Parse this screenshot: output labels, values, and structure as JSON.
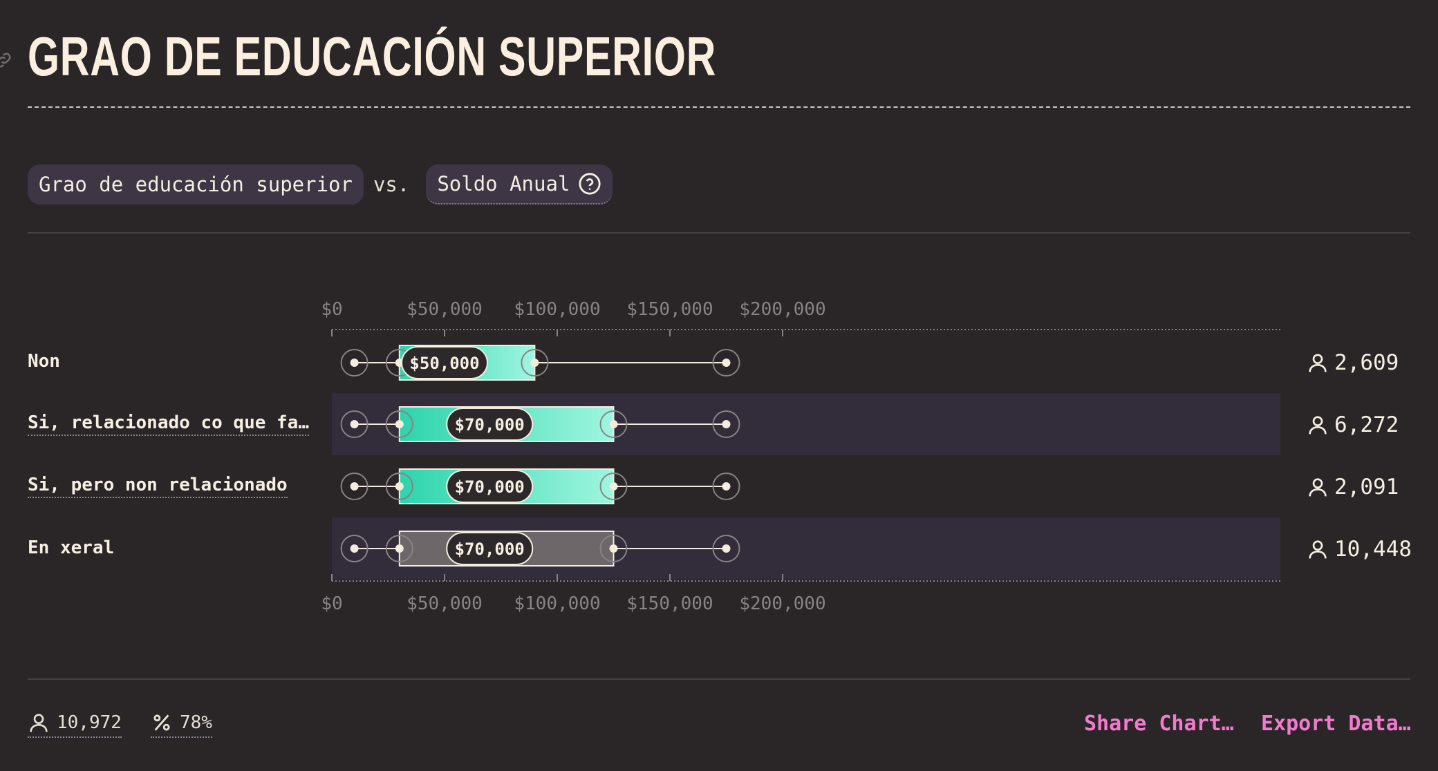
{
  "header": {
    "title": "GRAO DE EDUCACIÓN SUPERIOR"
  },
  "selector": {
    "dimension": "Grao de educación superior",
    "vs": "vs.",
    "metric": "Soldo Anual"
  },
  "rows": [
    {
      "label": "Non",
      "count": "2,609"
    },
    {
      "label": "Si, relacionado co que fa…",
      "count": "6,272"
    },
    {
      "label": "Si, pero non relacionado",
      "count": "2,091"
    },
    {
      "label": "En xeral",
      "count": "10,448"
    }
  ],
  "footer": {
    "respondents": "10,972",
    "percent": "78%",
    "share_label": "Share Chart…",
    "export_label": "Export Data…"
  },
  "colors": {
    "background": "#2a2628",
    "accent_link": "#f27bd0",
    "bar_start": "#2dd4ac",
    "bar_end": "#9ff6df",
    "overall_bar": "#6d6769",
    "row_highlight": "#332d3b"
  },
  "chart_data": {
    "type": "boxplot",
    "xlim": [
      0,
      210000
    ],
    "ticks": [
      0,
      50000,
      100000,
      150000,
      200000
    ],
    "tick_labels": [
      "$0",
      "$50,000",
      "$100,000",
      "$150,000",
      "$200,000"
    ],
    "series": [
      {
        "category": "Non",
        "p10": 10000,
        "p25": 30000,
        "median": 50000,
        "p75": 90000,
        "p90": 175000,
        "median_label": "$50,000"
      },
      {
        "category": "Si, relacionado co que fa…",
        "p10": 10000,
        "p25": 30000,
        "median": 70000,
        "p75": 125000,
        "p90": 175000,
        "median_label": "$70,000"
      },
      {
        "category": "Si, pero non relacionado",
        "p10": 10000,
        "p25": 30000,
        "median": 70000,
        "p75": 125000,
        "p90": 175000,
        "median_label": "$70,000"
      },
      {
        "category": "En xeral",
        "p10": 10000,
        "p25": 30000,
        "median": 70000,
        "p75": 125000,
        "p90": 175000,
        "median_label": "$70,000",
        "overall": true
      }
    ]
  }
}
